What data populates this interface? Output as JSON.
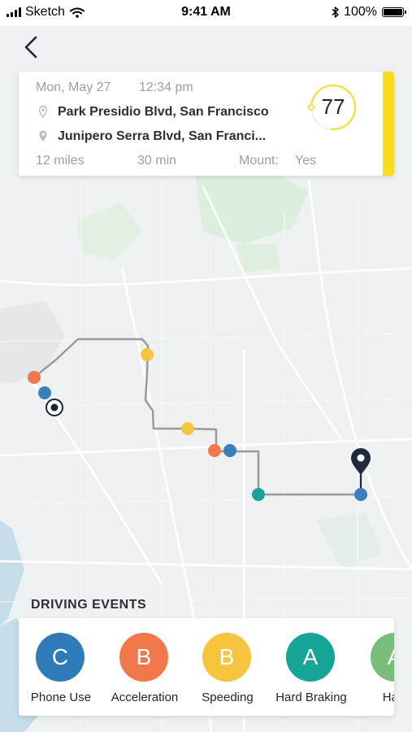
{
  "status_bar": {
    "carrier": "Sketch",
    "time": "9:41 AM",
    "battery": "100%",
    "battery_level": 1.0
  },
  "nav": {
    "back_icon": "chevron-left-icon"
  },
  "trip": {
    "date": "Mon, May 27",
    "time": "12:34 pm",
    "from": "Park Presidio Blvd, San Francisco",
    "to": "Junipero Serra Blvd, San Franci...",
    "distance": "12 miles",
    "duration": "30 min",
    "mount_label": "Mount:",
    "mount_value": "Yes",
    "score": "77",
    "score_fraction": 0.77,
    "accent_color": "#f7dc1f"
  },
  "map": {
    "route_color": "#9a9a9a",
    "end_marker_color": "#1f2a3a",
    "event_colors": {
      "phone_use": "#3a7fbd",
      "acceleration": "#f2774a",
      "speeding": "#f7c440",
      "hard_braking": "#17a597"
    }
  },
  "events": {
    "title": "DRIVING EVENTS",
    "items": [
      {
        "grade": "C",
        "label": "Phone Use",
        "color": "#2f7ab8"
      },
      {
        "grade": "B",
        "label": "Acceleration",
        "color": "#f2774a"
      },
      {
        "grade": "B",
        "label": "Speeding",
        "color": "#f7c440"
      },
      {
        "grade": "A",
        "label": "Hard Braking",
        "color": "#17a597"
      },
      {
        "grade": "A",
        "label": "Hard",
        "color": "#79bd7a"
      }
    ]
  }
}
